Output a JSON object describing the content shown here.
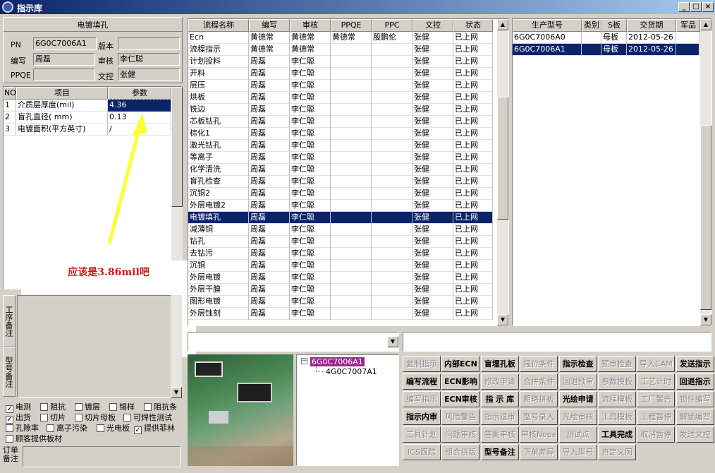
{
  "window": {
    "title": "指示库"
  },
  "left": {
    "section_title": "电镀填孔",
    "pn_label": "PN",
    "pn_value": "6G0C7006A1",
    "version_label": "版本",
    "version_value": "",
    "writer_label": "编写",
    "writer_value": "周磊",
    "reviewer_label": "审核",
    "reviewer_value": "李仁聪",
    "ppqe_label": "PPQE",
    "ppqe_value": "",
    "doc_label": "文控",
    "doc_value": "张健",
    "param_headers": {
      "no": "NO",
      "item": "项目",
      "param": "参数"
    },
    "params": [
      {
        "no": "1",
        "item": "介质层厚度(mil)",
        "value": "4.36"
      },
      {
        "no": "2",
        "item": "盲孔直径( mm)",
        "value": "0.13"
      },
      {
        "no": "3",
        "item": "电镀面积(平方英寸)",
        "value": "/"
      }
    ],
    "annotation": "应该是3.86mil吧",
    "vtab1": "工序备注",
    "vtab2": "型号备注",
    "checks": [
      {
        "label": "电测",
        "checked": true
      },
      {
        "label": "阻抗",
        "checked": false
      },
      {
        "label": "镀层",
        "checked": false
      },
      {
        "label": "锡样",
        "checked": false
      },
      {
        "label": "阻抗条",
        "checked": false
      },
      {
        "label": "出货",
        "checked": true
      },
      {
        "label": "切片",
        "checked": false
      },
      {
        "label": "切片母板",
        "checked": false
      },
      {
        "label": "可焊性测试",
        "checked": false
      },
      {
        "label": "孔隙率",
        "checked": false
      },
      {
        "label": "离子污染",
        "checked": false
      },
      {
        "label": "光电板",
        "checked": false
      },
      {
        "label": "提供菲林",
        "checked": true
      },
      {
        "label": "顾客提供板材",
        "checked": false
      }
    ],
    "order_note_label": "订单备注"
  },
  "process_table": {
    "headers": [
      "流程名称",
      "编写",
      "审核",
      "PPQE",
      "PPC",
      "文控",
      "状态"
    ],
    "rows": [
      [
        "Ecn",
        "黄德常",
        "黄德常",
        "黄德常",
        "殷鹏伦",
        "张健",
        "已上网"
      ],
      [
        "流程指示",
        "黄德常",
        "黄德常",
        "",
        "",
        "张健",
        "已上网"
      ],
      [
        "计划投料",
        "周磊",
        "李仁聪",
        "",
        "",
        "张健",
        "已上网"
      ],
      [
        "开料",
        "周磊",
        "李仁聪",
        "",
        "",
        "张健",
        "已上网"
      ],
      [
        "层压",
        "周磊",
        "李仁聪",
        "",
        "",
        "张健",
        "已上网"
      ],
      [
        "烘板",
        "周磊",
        "李仁聪",
        "",
        "",
        "张健",
        "已上网"
      ],
      [
        "铣边",
        "周磊",
        "李仁聪",
        "",
        "",
        "张健",
        "已上网"
      ],
      [
        "芯板钻孔",
        "周磊",
        "李仁聪",
        "",
        "",
        "张健",
        "已上网"
      ],
      [
        "棕化1",
        "周磊",
        "李仁聪",
        "",
        "",
        "张健",
        "已上网"
      ],
      [
        "激光钻孔",
        "周磊",
        "李仁聪",
        "",
        "",
        "张健",
        "已上网"
      ],
      [
        "等离子",
        "周磊",
        "李仁聪",
        "",
        "",
        "张健",
        "已上网"
      ],
      [
        "化学清洗",
        "周磊",
        "李仁聪",
        "",
        "",
        "张健",
        "已上网"
      ],
      [
        "盲孔检查",
        "周磊",
        "李仁聪",
        "",
        "",
        "张健",
        "已上网"
      ],
      [
        "沉铜2",
        "周磊",
        "李仁聪",
        "",
        "",
        "张健",
        "已上网"
      ],
      [
        "外层电镀2",
        "周磊",
        "李仁聪",
        "",
        "",
        "张健",
        "已上网"
      ],
      [
        "电镀填孔",
        "周磊",
        "李仁聪",
        "",
        "",
        "张健",
        "已上网"
      ],
      [
        "减薄铜",
        "周磊",
        "李仁聪",
        "",
        "",
        "张健",
        "已上网"
      ],
      [
        "钻孔",
        "周磊",
        "李仁聪",
        "",
        "",
        "张健",
        "已上网"
      ],
      [
        "去钻污",
        "周磊",
        "李仁聪",
        "",
        "",
        "张健",
        "已上网"
      ],
      [
        "沉铜",
        "周磊",
        "李仁聪",
        "",
        "",
        "张健",
        "已上网"
      ],
      [
        "外层电镀",
        "周磊",
        "李仁聪",
        "",
        "",
        "张健",
        "已上网"
      ],
      [
        "外层干膜",
        "周磊",
        "李仁聪",
        "",
        "",
        "张健",
        "已上网"
      ],
      [
        "图形电镀",
        "周磊",
        "李仁聪",
        "",
        "",
        "张健",
        "已上网"
      ],
      [
        "外层蚀刻",
        "周磊",
        "李仁聪",
        "",
        "",
        "张健",
        "已上网"
      ]
    ],
    "selected_index": 15
  },
  "product_table": {
    "headers": [
      "生产型号",
      "类别",
      "S板",
      "交货期",
      "军品"
    ],
    "rows": [
      [
        "6G0C7006A0",
        "",
        "母板",
        "2012-05-26",
        ""
      ],
      [
        "6G0C7006A1",
        "",
        "母板",
        "2012-05-26",
        ""
      ]
    ],
    "selected_index": 1
  },
  "tree": {
    "root": "6G0C7006A1",
    "child": "4G0C7007A1"
  },
  "buttons": [
    [
      {
        "l": "复制指示",
        "d": true
      },
      {
        "l": "内部ECN",
        "d": false
      },
      {
        "l": "盲埋孔板",
        "d": false
      },
      {
        "l": "报价条件",
        "d": true
      },
      {
        "l": "指示检查",
        "d": false
      },
      {
        "l": "预审检查",
        "d": true
      },
      {
        "l": "导入CAM",
        "d": true
      },
      {
        "l": "发送指示",
        "d": false
      }
    ],
    [
      {
        "l": "编写流程",
        "d": false
      },
      {
        "l": "ECN影响",
        "d": false
      },
      {
        "l": "修改申请",
        "d": true
      },
      {
        "l": "合拼条件",
        "d": true
      },
      {
        "l": "回退预审",
        "d": true
      },
      {
        "l": "参数模板",
        "d": true
      },
      {
        "l": "工艺计时",
        "d": true
      },
      {
        "l": "回退指示",
        "d": false
      }
    ],
    [
      {
        "l": "编写指示",
        "d": true
      },
      {
        "l": "ECN审核",
        "d": false
      },
      {
        "l": "指 示 库",
        "d": false
      },
      {
        "l": "粗略拼板",
        "d": true
      },
      {
        "l": "光绘申请",
        "d": false
      },
      {
        "l": "流程模板",
        "d": true
      },
      {
        "l": "工厂警告",
        "d": true
      },
      {
        "l": "锁住编写",
        "d": true
      }
    ],
    [
      {
        "l": "指示内审",
        "d": false
      },
      {
        "l": "风险警告",
        "d": true
      },
      {
        "l": "指示退审",
        "d": true
      },
      {
        "l": "型号录入",
        "d": true
      },
      {
        "l": "光绘审核",
        "d": true
      },
      {
        "l": "工具模板",
        "d": true
      },
      {
        "l": "工程暂停",
        "d": true
      },
      {
        "l": "解锁编写",
        "d": true
      }
    ],
    [
      {
        "l": "工具计划",
        "d": true
      },
      {
        "l": "问题审核",
        "d": true
      },
      {
        "l": "答案审核",
        "d": true
      },
      {
        "l": "审核Nope",
        "d": true
      },
      {
        "l": "测试点",
        "d": true
      },
      {
        "l": "工具完成",
        "d": false
      },
      {
        "l": "取消暂停",
        "d": true
      },
      {
        "l": "发送文控",
        "d": true
      }
    ],
    [
      {
        "l": "ICS跟踪",
        "d": true
      },
      {
        "l": "组合拼版",
        "d": true
      },
      {
        "l": "型号备注",
        "d": false
      },
      {
        "l": "下单差异",
        "d": true
      },
      {
        "l": "导入型号",
        "d": true
      },
      {
        "l": "自定义图",
        "d": true
      }
    ]
  ],
  "colors": {
    "selection": "#0a246a",
    "annotation_text": "#d01818",
    "arrow": "#ffff33",
    "face": "#d4d0c8"
  }
}
